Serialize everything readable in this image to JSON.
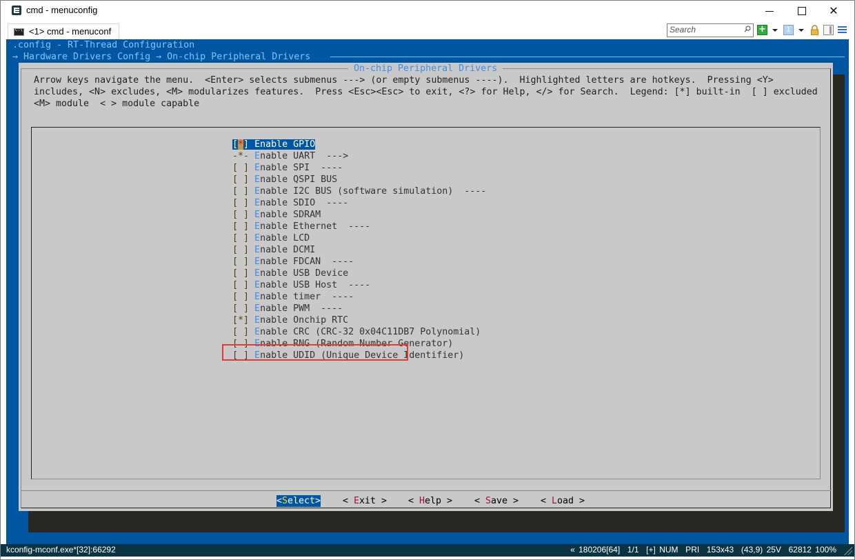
{
  "window": {
    "title": "cmd - menuconfig",
    "tab_label": "<1> cmd - menuconf",
    "search_placeholder": "Search",
    "controls": {
      "minimize": "minimize",
      "maximize": "maximize",
      "close": "✕"
    }
  },
  "terminal": {
    "config_title": ".config - RT-Thread Configuration",
    "breadcrumb": "→ Hardware Drivers Config → On-chip Peripheral Drivers",
    "dialog_title": "On-chip Peripheral Drivers",
    "help_lines": [
      "Arrow keys navigate the menu.  <Enter> selects submenus ---> (or empty submenus ----).  Highlighted letters are hotkeys.  Pressing <Y>",
      "includes, <N> excludes, <M> modularizes features.  Press <Esc><Esc> to exit, <?> for Help, </> for Search.  Legend: [*] built-in  [ ] excluded",
      "<M> module  < > module capable"
    ],
    "menu_items": [
      {
        "mark": "[*]",
        "hotkey": "E",
        "rest": "nable GPIO",
        "suffix": "",
        "selected": true
      },
      {
        "mark": "-*-",
        "hotkey": "E",
        "rest": "nable UART",
        "suffix": "  --->",
        "selected": false
      },
      {
        "mark": "[ ]",
        "hotkey": "E",
        "rest": "nable SPI",
        "suffix": "  ----",
        "selected": false
      },
      {
        "mark": "[ ]",
        "hotkey": "E",
        "rest": "nable QSPI BUS",
        "suffix": "",
        "selected": false
      },
      {
        "mark": "[ ]",
        "hotkey": "E",
        "rest": "nable I2C BUS (software simulation)",
        "suffix": "  ----",
        "selected": false
      },
      {
        "mark": "[ ]",
        "hotkey": "E",
        "rest": "nable SDIO",
        "suffix": "  ----",
        "selected": false
      },
      {
        "mark": "[ ]",
        "hotkey": "E",
        "rest": "nable SDRAM",
        "suffix": "",
        "selected": false
      },
      {
        "mark": "[ ]",
        "hotkey": "E",
        "rest": "nable Ethernet",
        "suffix": "  ----",
        "selected": false
      },
      {
        "mark": "[ ]",
        "hotkey": "E",
        "rest": "nable LCD",
        "suffix": "",
        "selected": false
      },
      {
        "mark": "[ ]",
        "hotkey": "E",
        "rest": "nable DCMI",
        "suffix": "",
        "selected": false
      },
      {
        "mark": "[ ]",
        "hotkey": "E",
        "rest": "nable FDCAN",
        "suffix": "  ----",
        "selected": false
      },
      {
        "mark": "[ ]",
        "hotkey": "E",
        "rest": "nable USB Device",
        "suffix": "",
        "selected": false
      },
      {
        "mark": "[ ]",
        "hotkey": "E",
        "rest": "nable USB Host",
        "suffix": "  ----",
        "selected": false
      },
      {
        "mark": "[ ]",
        "hotkey": "E",
        "rest": "nable timer",
        "suffix": "  ----",
        "selected": false
      },
      {
        "mark": "[ ]",
        "hotkey": "E",
        "rest": "nable PWM",
        "suffix": "  ----",
        "selected": false
      },
      {
        "mark": "[*]",
        "hotkey": "E",
        "rest": "nable Onchip RTC",
        "suffix": "",
        "selected": false,
        "annotated": true
      },
      {
        "mark": "[ ]",
        "hotkey": "E",
        "rest": "nable CRC (CRC-32 0x04C11DB7 Polynomial)",
        "suffix": "",
        "selected": false
      },
      {
        "mark": "[ ]",
        "hotkey": "E",
        "rest": "nable RNG (Random Number Generator)",
        "suffix": "",
        "selected": false
      },
      {
        "mark": "[ ]",
        "hotkey": "E",
        "rest": "nable UDID (Unique Device Identifier)",
        "suffix": "",
        "selected": false
      }
    ],
    "buttons": [
      {
        "pre": "<",
        "hotkey": "S",
        "rest": "elect>",
        "active": true
      },
      {
        "pre": "< ",
        "hotkey": "E",
        "rest": "xit >",
        "active": false
      },
      {
        "pre": "< ",
        "hotkey": "H",
        "rest": "elp >",
        "active": false
      },
      {
        "pre": "< ",
        "hotkey": "S",
        "rest": "ave >",
        "active": false
      },
      {
        "pre": "< ",
        "hotkey": "L",
        "rest": "oad >",
        "active": false
      }
    ]
  },
  "status_bar": {
    "process": "kconfig-mconf.exe*[32]:66292",
    "info": "« 180206[64]  1/1  [+] NUM  PRI  153x43  (43,9) 25V  62812 100%"
  },
  "colors": {
    "terminal_bg": "#0056a0",
    "dialog_bg": "#c9c9c9",
    "accent_text": "#3c8ee3",
    "annotation_box": "#e53935",
    "status_bg": "#0a3444"
  }
}
